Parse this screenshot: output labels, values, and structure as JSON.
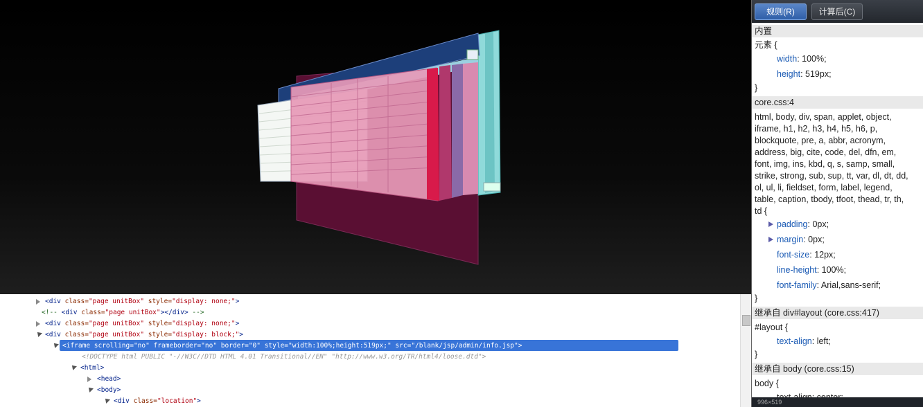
{
  "tabs": {
    "rules": "规则(R)",
    "computed": "计算后(C)"
  },
  "styles": {
    "inline_header": "内置",
    "inline_selector": "元素 {",
    "inline_props": [
      {
        "name": "width",
        "value": "100%;"
      },
      {
        "name": "height",
        "value": "519px;"
      }
    ],
    "core_header": "core.css:4",
    "core_selector_lines": [
      "html, body, div, span, applet, object,",
      "iframe, h1, h2, h3, h4, h5, h6, p,",
      "blockquote, pre, a, abbr, acronym,",
      "address, big, cite, code, del, dfn, em,",
      "font, img, ins, kbd, q, s, samp, small,",
      "strike, strong, sub, sup, tt, var, dl, dt, dd,",
      "ol, ul, li, fieldset, form, label, legend,",
      "table, caption, tbody, tfoot, thead, tr, th,",
      "td {"
    ],
    "core_props": [
      {
        "name": "padding",
        "value": "0px;"
      },
      {
        "name": "margin",
        "value": "0px;"
      },
      {
        "name": "font-size",
        "value": "12px;"
      },
      {
        "name": "line-height",
        "value": "100%;"
      },
      {
        "name": "font-family",
        "value": "Arial,sans-serif;"
      }
    ],
    "closing_brace": "}",
    "inherit1_header": "继承自 div#layout (core.css:417)",
    "inherit1_selector": "#layout {",
    "inherit1_props": [
      {
        "name": "text-align",
        "value": "left;"
      }
    ],
    "inherit2_header": "继承自 body (core.css:15)",
    "inherit2_selector": "body {",
    "inherit2_partial": "text-align: center;",
    "status_text": "996×519"
  },
  "dom": {
    "lines": [
      {
        "parts": [
          [
            "tag",
            "<div "
          ],
          [
            "attr",
            "class="
          ],
          [
            "val",
            "\"page unitBox\""
          ],
          [
            "attr",
            " style="
          ],
          [
            "val",
            "\"display: none;\""
          ],
          [
            "tag",
            ">"
          ]
        ]
      },
      {
        "parts": [
          [
            "cmt",
            "<!-- "
          ],
          [
            "tag",
            "<div "
          ],
          [
            "attr",
            "class="
          ],
          [
            "val",
            "\"page unitBox\""
          ],
          [
            "tag",
            "></div>"
          ],
          [
            "cmt",
            " -->"
          ]
        ]
      },
      {
        "parts": [
          [
            "tag",
            "<div "
          ],
          [
            "attr",
            "class="
          ],
          [
            "val",
            "\"page unitBox\""
          ],
          [
            "attr",
            " style="
          ],
          [
            "val",
            "\"display: none;\""
          ],
          [
            "tag",
            ">"
          ]
        ]
      },
      {
        "parts": [
          [
            "tag",
            "<div "
          ],
          [
            "attr",
            "class="
          ],
          [
            "val",
            "\"page unitBox\""
          ],
          [
            "attr",
            " style="
          ],
          [
            "val",
            "\"display: block;\""
          ],
          [
            "tag",
            ">"
          ]
        ]
      },
      {
        "text": "<iframe scrolling=\"no\" frameborder=\"no\" border=\"0\" style=\"width:100%;height:519px;\" src=\"/blank/jsp/admin/info.jsp\">"
      },
      {
        "text": "<!DOCTYPE html PUBLIC \"-//W3C//DTD HTML 4.01 Transitional//EN\" \"http://www.w3.org/TR/html4/loose.dtd\">"
      },
      {
        "text": "<html>"
      },
      {
        "text": "<head>"
      },
      {
        "text": "<body>"
      },
      {
        "parts": [
          [
            "tag",
            "<div "
          ],
          [
            "attr",
            "class="
          ],
          [
            "val",
            "\"location\""
          ],
          [
            "tag",
            ">"
          ]
        ]
      }
    ]
  },
  "colors": {
    "viewport_bg": "#000000",
    "selection": "#3874d8",
    "layer_pink": "#e89ab8",
    "layer_dark": "#5a0f33",
    "layer_cyan": "#7fd6d6"
  },
  "icons": {
    "expanded": "triangle-down-icon",
    "collapsed": "triangle-right-icon"
  }
}
